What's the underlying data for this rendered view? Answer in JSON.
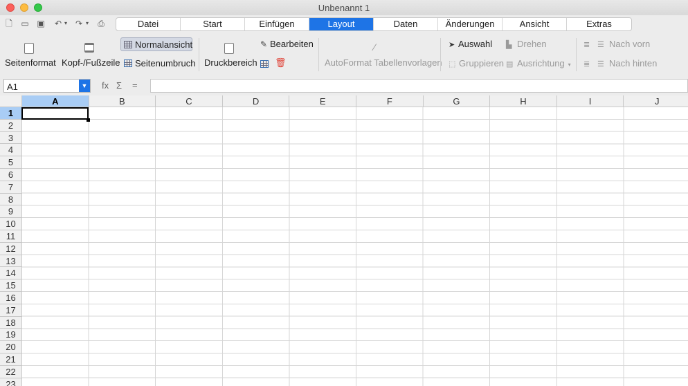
{
  "window": {
    "title": "Unbenannt 1"
  },
  "tabs": [
    {
      "label": "Datei",
      "active": false
    },
    {
      "label": "Start",
      "active": false
    },
    {
      "label": "Einfügen",
      "active": false
    },
    {
      "label": "Layout",
      "active": true
    },
    {
      "label": "Daten",
      "active": false
    },
    {
      "label": "Änderungen",
      "active": false
    },
    {
      "label": "Ansicht",
      "active": false
    },
    {
      "label": "Extras",
      "active": false
    }
  ],
  "ribbon": {
    "seitenformat": "Seitenformat",
    "kopf_fusszeile": "Kopf-/Fußzeile",
    "normalansicht": "Normalansicht",
    "seitenumbruch": "Seitenumbruch",
    "druckbereich": "Druckbereich",
    "bearbeiten": "Bearbeiten",
    "autoformat": "AutoFormat Tabellenvorlagen",
    "auswahl": "Auswahl",
    "drehen": "Drehen",
    "gruppieren": "Gruppieren",
    "ausrichtung": "Ausrichtung",
    "nach_vorn": "Nach vorn",
    "nach_hinten": "Nach hinten"
  },
  "formula_bar": {
    "cell_ref": "A1",
    "fx": "fx",
    "sigma": "Σ",
    "equals": "=",
    "formula": ""
  },
  "sheet": {
    "columns": [
      "A",
      "B",
      "C",
      "D",
      "E",
      "F",
      "G",
      "H",
      "I",
      "J"
    ],
    "rows": [
      "1",
      "2",
      "3",
      "4",
      "5",
      "6",
      "7",
      "8",
      "9",
      "10",
      "11",
      "12",
      "13",
      "14",
      "15",
      "16",
      "17",
      "18",
      "19",
      "20",
      "21",
      "22",
      "23"
    ],
    "selected_cell": "A1"
  },
  "colors": {
    "accent": "#1e74e6",
    "selection_header": "#a9cdf5"
  }
}
